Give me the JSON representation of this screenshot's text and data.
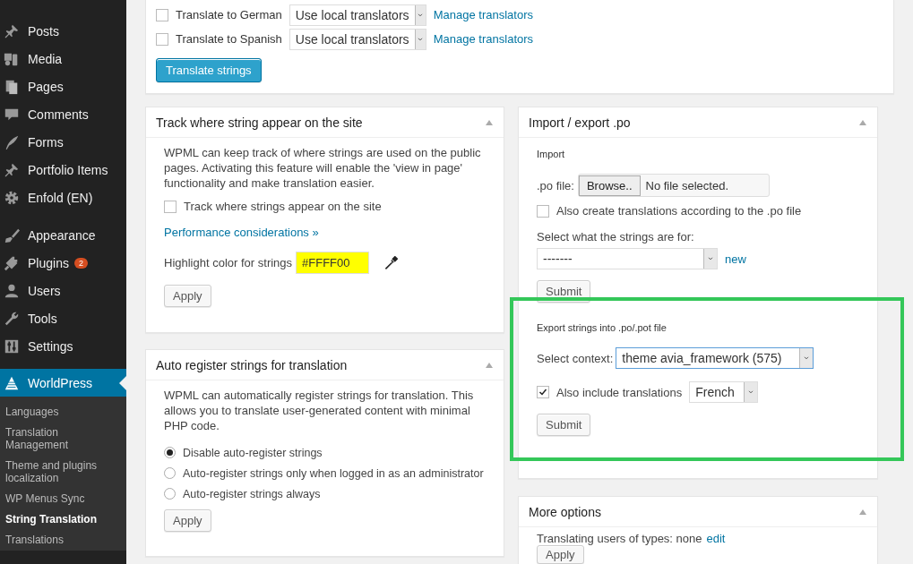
{
  "sidebar": {
    "menu": [
      {
        "label": "Posts",
        "selected": false
      },
      {
        "label": "Media",
        "selected": false
      },
      {
        "label": "Pages",
        "selected": false
      },
      {
        "label": "Comments",
        "selected": false
      },
      {
        "label": "Forms",
        "selected": false
      },
      {
        "label": "Portfolio Items",
        "selected": false
      },
      {
        "label": "Enfold (EN)",
        "selected": false
      },
      {
        "label": "Appearance",
        "selected": false
      },
      {
        "label": "Plugins",
        "selected": false,
        "badge": "2"
      },
      {
        "label": "Users",
        "selected": false
      },
      {
        "label": "Tools",
        "selected": false
      },
      {
        "label": "Settings",
        "selected": false
      },
      {
        "label": "WorldPress",
        "selected": true
      }
    ],
    "submenu": [
      {
        "label": "Languages",
        "selected": false
      },
      {
        "label": "Translation Management",
        "selected": false
      },
      {
        "label": "Theme and plugins localization",
        "selected": false
      },
      {
        "label": "WP Menus Sync",
        "selected": false
      },
      {
        "label": "String Translation",
        "selected": true
      },
      {
        "label": "Translations",
        "selected": false
      }
    ]
  },
  "translate_card": {
    "rows": [
      {
        "label": "Translate to German",
        "checked": false,
        "select": "Use local translators",
        "link": "Manage translators"
      },
      {
        "label": "Translate to Spanish",
        "checked": false,
        "select": "Use local translators",
        "link": "Manage translators"
      }
    ],
    "button": "Translate strings"
  },
  "track_card": {
    "title": "Track where string appear on the site",
    "description": "WPML can keep track of where strings are used on the public pages. Activating this feature will enable the 'view in page' functionality and make translation easier.",
    "checkbox": {
      "label": "Track where strings appear on the site",
      "checked": false
    },
    "link": "Performance considerations »",
    "highlight_label": "Highlight color for strings",
    "highlight_value": "#FFFF00",
    "button": "Apply"
  },
  "auto_card": {
    "title": "Auto register strings for translation",
    "description": "WPML can automatically register strings for translation. This allows you to translate user-generated content with minimal PHP code.",
    "radios": [
      {
        "label": "Disable auto-register strings",
        "selected": true
      },
      {
        "label": "Auto-register strings only when logged in as an administrator",
        "selected": false
      },
      {
        "label": "Auto-register strings always",
        "selected": false
      }
    ],
    "button": "Apply"
  },
  "import_card": {
    "title": "Import / export .po",
    "import": {
      "heading": "Import",
      "file_label": ".po file:",
      "browse": "Browse..",
      "file_status": "No file selected.",
      "checkbox": {
        "label": "Also create translations according to the .po file",
        "checked": false
      },
      "select_label": "Select what the strings are for:",
      "select": "-------",
      "link": "new",
      "button": "Submit"
    },
    "export": {
      "highlighted": true,
      "heading": "Export strings into .po/.pot file",
      "context_label": "Select context:",
      "context": "theme avia_framework (575)",
      "checkbox": {
        "label": "Also include translations",
        "checked": true
      },
      "language": "French",
      "button": "Submit"
    }
  },
  "more_card": {
    "title": "More options",
    "text": "Translating users of types: none",
    "link": "edit",
    "button": "Apply"
  }
}
